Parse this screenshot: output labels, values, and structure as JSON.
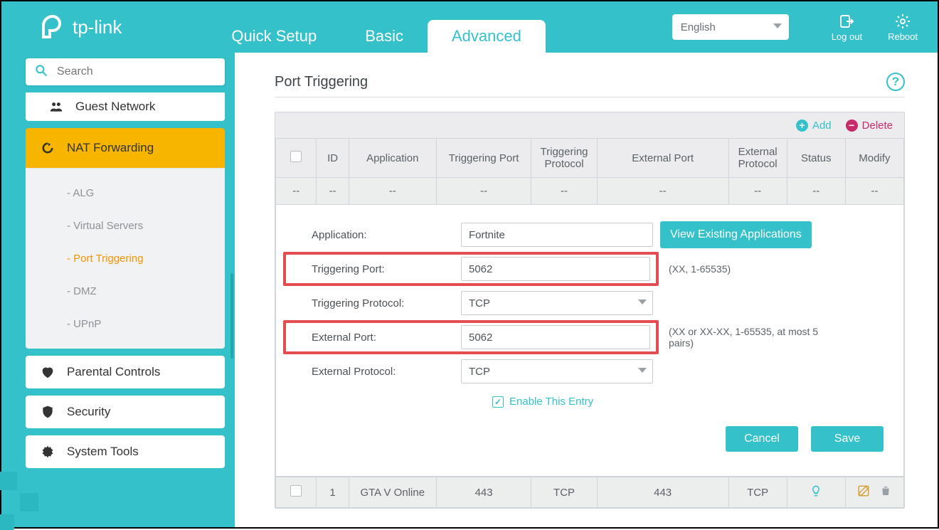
{
  "brand": "tp-link",
  "header": {
    "tabs": {
      "quick_setup": "Quick Setup",
      "basic": "Basic",
      "advanced": "Advanced"
    },
    "active_tab": "advanced",
    "language": "English",
    "logout": "Log out",
    "reboot": "Reboot"
  },
  "search_placeholder": "Search",
  "sidebar": {
    "items": [
      {
        "id": "guest-network",
        "label": "Guest Network"
      },
      {
        "id": "nat-forwarding",
        "label": "NAT Forwarding"
      },
      {
        "id": "parental-controls",
        "label": "Parental Controls"
      },
      {
        "id": "security",
        "label": "Security"
      },
      {
        "id": "system-tools",
        "label": "System Tools"
      }
    ],
    "active": "nat-forwarding",
    "nat_children": [
      {
        "id": "alg",
        "label": "- ALG"
      },
      {
        "id": "virtual-servers",
        "label": "- Virtual Servers"
      },
      {
        "id": "port-triggering",
        "label": "- Port Triggering"
      },
      {
        "id": "dmz",
        "label": "- DMZ"
      },
      {
        "id": "upnp",
        "label": "- UPnP"
      }
    ],
    "active_child": "port-triggering"
  },
  "page": {
    "title": "Port Triggering",
    "toolbar": {
      "add": "Add",
      "delete": "Delete"
    },
    "columns": {
      "id": "ID",
      "application": "Application",
      "trig_port": "Triggering Port",
      "trig_proto": "Triggering Protocol",
      "ext_port": "External Port",
      "ext_proto": "External Protocol",
      "status": "Status",
      "modify": "Modify"
    },
    "empty": "--",
    "rows": [
      {
        "id": "1",
        "app": "GTA V Online",
        "tp": "443",
        "tpp": "TCP",
        "ep": "443",
        "epp": "TCP"
      }
    ]
  },
  "form": {
    "labels": {
      "application": "Application:",
      "trig_port": "Triggering Port:",
      "trig_proto": "Triggering Protocol:",
      "ext_port": "External Port:",
      "ext_proto": "External Protocol:"
    },
    "values": {
      "application": "Fortnite",
      "trig_port": "5062",
      "trig_proto": "TCP",
      "ext_port": "5062",
      "ext_proto": "TCP"
    },
    "hints": {
      "trig_port": "(XX, 1-65535)",
      "ext_port": "(XX or XX-XX, 1-65535, at most 5 pairs)"
    },
    "view_existing": "View Existing Applications",
    "enable": "Enable This Entry",
    "cancel": "Cancel",
    "save": "Save"
  }
}
